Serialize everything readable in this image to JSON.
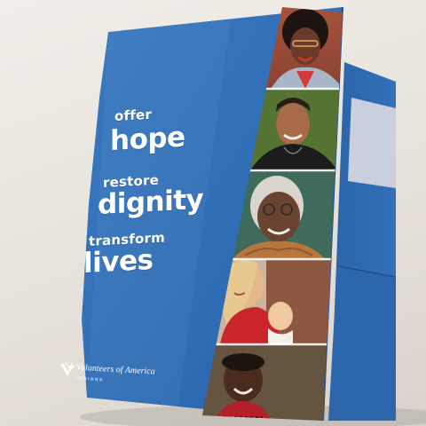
{
  "tagline": {
    "offer": "offer",
    "hope": "hope",
    "restore": "restore",
    "dignity": "dignity",
    "transform": "transform",
    "lives": "lives"
  },
  "logo": {
    "name": "Volunteers of America",
    "region": "INDIANA",
    "mark": "voa-logo-mark"
  },
  "colors": {
    "folder_blue": "#2f6db5",
    "folder_blue_dark": "#235a9b",
    "background": "#e9e5df",
    "text": "#ffffff"
  },
  "photos": [
    {
      "name": "photo-woman-glasses-curly-hair"
    },
    {
      "name": "photo-smiling-man"
    },
    {
      "name": "photo-elderly-woman-glasses"
    },
    {
      "name": "photo-mother-with-baby"
    },
    {
      "name": "photo-smiling-child"
    }
  ]
}
